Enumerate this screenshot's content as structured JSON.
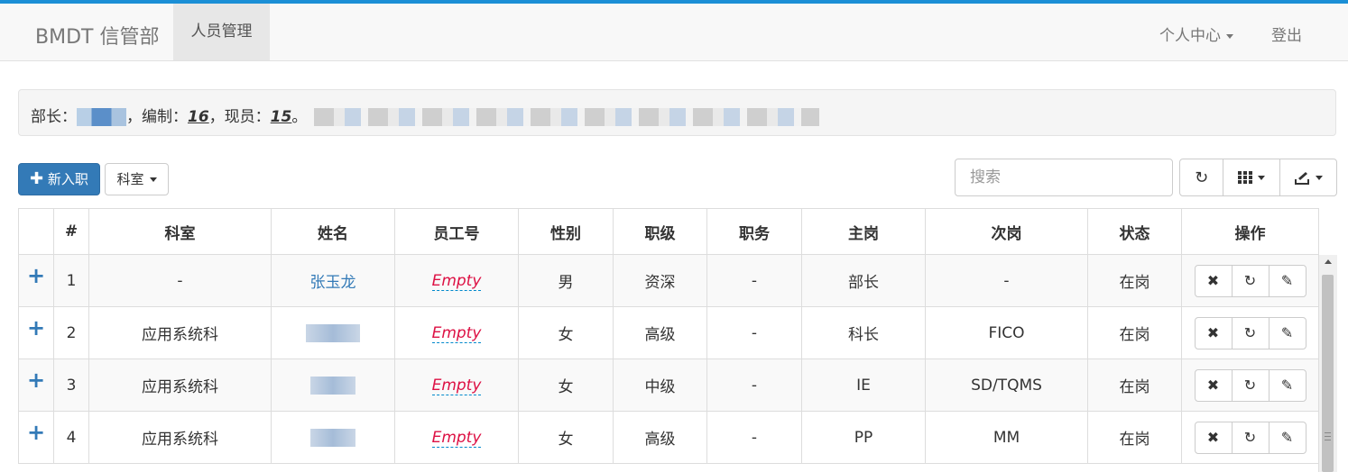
{
  "navbar": {
    "brand": "BMDT 信管部",
    "active_tab": "人员管理",
    "user_menu": "个人中心",
    "logout": "登出"
  },
  "summary": {
    "head_label": "部长：",
    "quota_label": "，编制：",
    "quota": "16",
    "current_label": "，现员：",
    "current": "15",
    "end": "。"
  },
  "toolbar": {
    "new_hire": "新入职",
    "dept_filter": "科室",
    "search_placeholder": "搜索",
    "refresh_icon": "refresh-icon",
    "columns_icon": "columns-grid-icon",
    "export_icon": "export-icon"
  },
  "table": {
    "columns": [
      "",
      "#",
      "科室",
      "姓名",
      "员工号",
      "性别",
      "职级",
      "职务",
      "主岗",
      "次岗",
      "状态",
      "操作"
    ],
    "rows": [
      {
        "no": "1",
        "dept": "-",
        "name": "张玉龙",
        "emp_id": "Empty",
        "gender": "男",
        "rank": "资深",
        "title": "-",
        "primary": "部长",
        "secondary": "-",
        "status": "在岗"
      },
      {
        "no": "2",
        "dept": "应用系统科",
        "name": "",
        "emp_id": "Empty",
        "gender": "女",
        "rank": "高级",
        "title": "-",
        "primary": "科长",
        "secondary": "FICO",
        "status": "在岗"
      },
      {
        "no": "3",
        "dept": "应用系统科",
        "name": "",
        "emp_id": "Empty",
        "gender": "女",
        "rank": "中级",
        "title": "-",
        "primary": "IE",
        "secondary": "SD/TQMS",
        "status": "在岗"
      },
      {
        "no": "4",
        "dept": "应用系统科",
        "name": "",
        "emp_id": "Empty",
        "gender": "女",
        "rank": "高级",
        "title": "-",
        "primary": "PP",
        "secondary": "MM",
        "status": "在岗"
      }
    ]
  },
  "colors": {
    "accent": "#337ab7",
    "empty_text": "#dd1144",
    "top_bar": "#1b8fd6"
  }
}
